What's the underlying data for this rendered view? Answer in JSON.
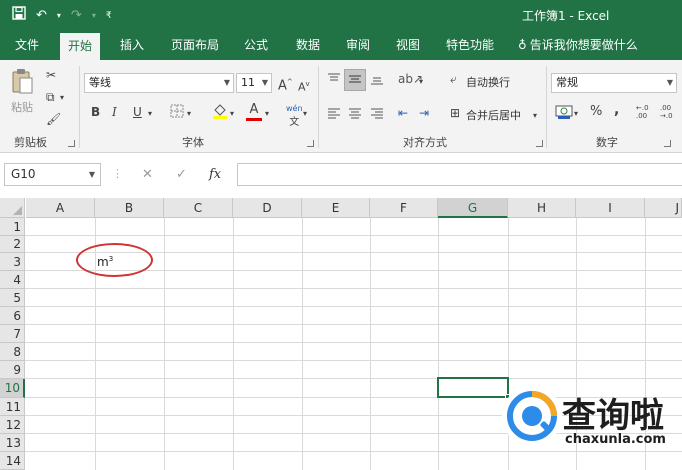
{
  "titlebar": {
    "save_icon": "save-icon",
    "undo_icon": "undo-icon",
    "redo_icon": "redo-icon",
    "customize_icon": "customize-qat-icon",
    "title": "工作簿1 - Excel"
  },
  "tabs": [
    {
      "label": "文件"
    },
    {
      "label": "开始",
      "active": true
    },
    {
      "label": "插入"
    },
    {
      "label": "页面布局"
    },
    {
      "label": "公式"
    },
    {
      "label": "数据"
    },
    {
      "label": "审阅"
    },
    {
      "label": "视图"
    },
    {
      "label": "特色功能"
    },
    {
      "label": "告诉我你想要做什么"
    }
  ],
  "ribbon": {
    "clipboard": {
      "paste_label": "粘贴",
      "group_label": "剪贴板"
    },
    "font": {
      "font_name": "等线",
      "font_size": "11",
      "bold": "B",
      "italic": "I",
      "underline": "U",
      "grow": "A",
      "shrink": "A",
      "font_color_glyph": "A",
      "phonetic": "wén",
      "group_label": "字体"
    },
    "alignment": {
      "wrap_text": "自动换行",
      "merge_center": "合并后居中",
      "group_label": "对齐方式"
    },
    "number": {
      "format": "常规",
      "percent": "%",
      "comma": ",",
      "inc_decimal": "←.0 .00",
      "dec_decimal": ".00 →.0",
      "group_label": "数字"
    }
  },
  "formula_bar": {
    "name_box": "G10",
    "fx": "fx",
    "cancel": "✕",
    "enter": "✓",
    "content": ""
  },
  "sheet": {
    "columns": [
      "A",
      "B",
      "C",
      "D",
      "E",
      "F",
      "G",
      "H",
      "I",
      "J"
    ],
    "rows": [
      "1",
      "2",
      "3",
      "4",
      "5",
      "6",
      "7",
      "8",
      "9",
      "10",
      "11",
      "12",
      "13",
      "14"
    ],
    "selected_cell": "G10",
    "cell_b3_base": "m",
    "cell_b3_sup": "3"
  },
  "watermark": {
    "text": "查询啦",
    "sub": "chaxunla.com"
  },
  "colors": {
    "excel_green": "#217346",
    "annotation_red": "#d03434"
  }
}
